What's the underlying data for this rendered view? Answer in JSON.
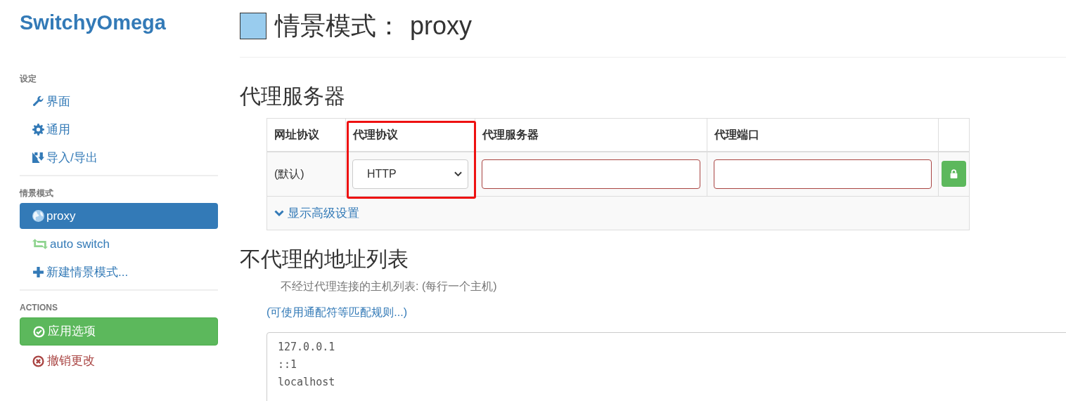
{
  "brand": "SwitchyOmega",
  "sidebar": {
    "sections": [
      {
        "header": "设定",
        "items": [
          {
            "label": "界面",
            "selected": false
          },
          {
            "label": "通用",
            "selected": false
          },
          {
            "label": "导入/导出",
            "selected": false
          }
        ]
      },
      {
        "header": "情景模式",
        "items": [
          {
            "label": "proxy",
            "selected": true
          },
          {
            "label": "auto switch",
            "selected": false
          },
          {
            "label": "新建情景模式...",
            "selected": false
          }
        ]
      },
      {
        "header": "ACTIONS",
        "actions": [
          {
            "label": "应用选项",
            "kind": "apply"
          },
          {
            "label": "撤销更改",
            "kind": "discard"
          }
        ]
      }
    ]
  },
  "page": {
    "title_label": "情景模式：",
    "profile_name": "proxy",
    "proxy_servers": {
      "heading": "代理服务器",
      "columns": [
        "网址协议",
        "代理协议",
        "代理服务器",
        "代理端口"
      ],
      "row": {
        "scheme": "(默认)",
        "protocol": "HTTP",
        "server": {
          "invalid": true
        },
        "port": {
          "invalid": true
        }
      },
      "advanced_link": "显示高级设置"
    },
    "bypass": {
      "heading": "不代理的地址列表",
      "description": "不经过代理连接的主机列表: (每行一个主机)",
      "help_link": "(可使用通配符等匹配规则...)",
      "hosts": [
        "127.0.0.1",
        "::1",
        "localhost"
      ]
    }
  }
}
